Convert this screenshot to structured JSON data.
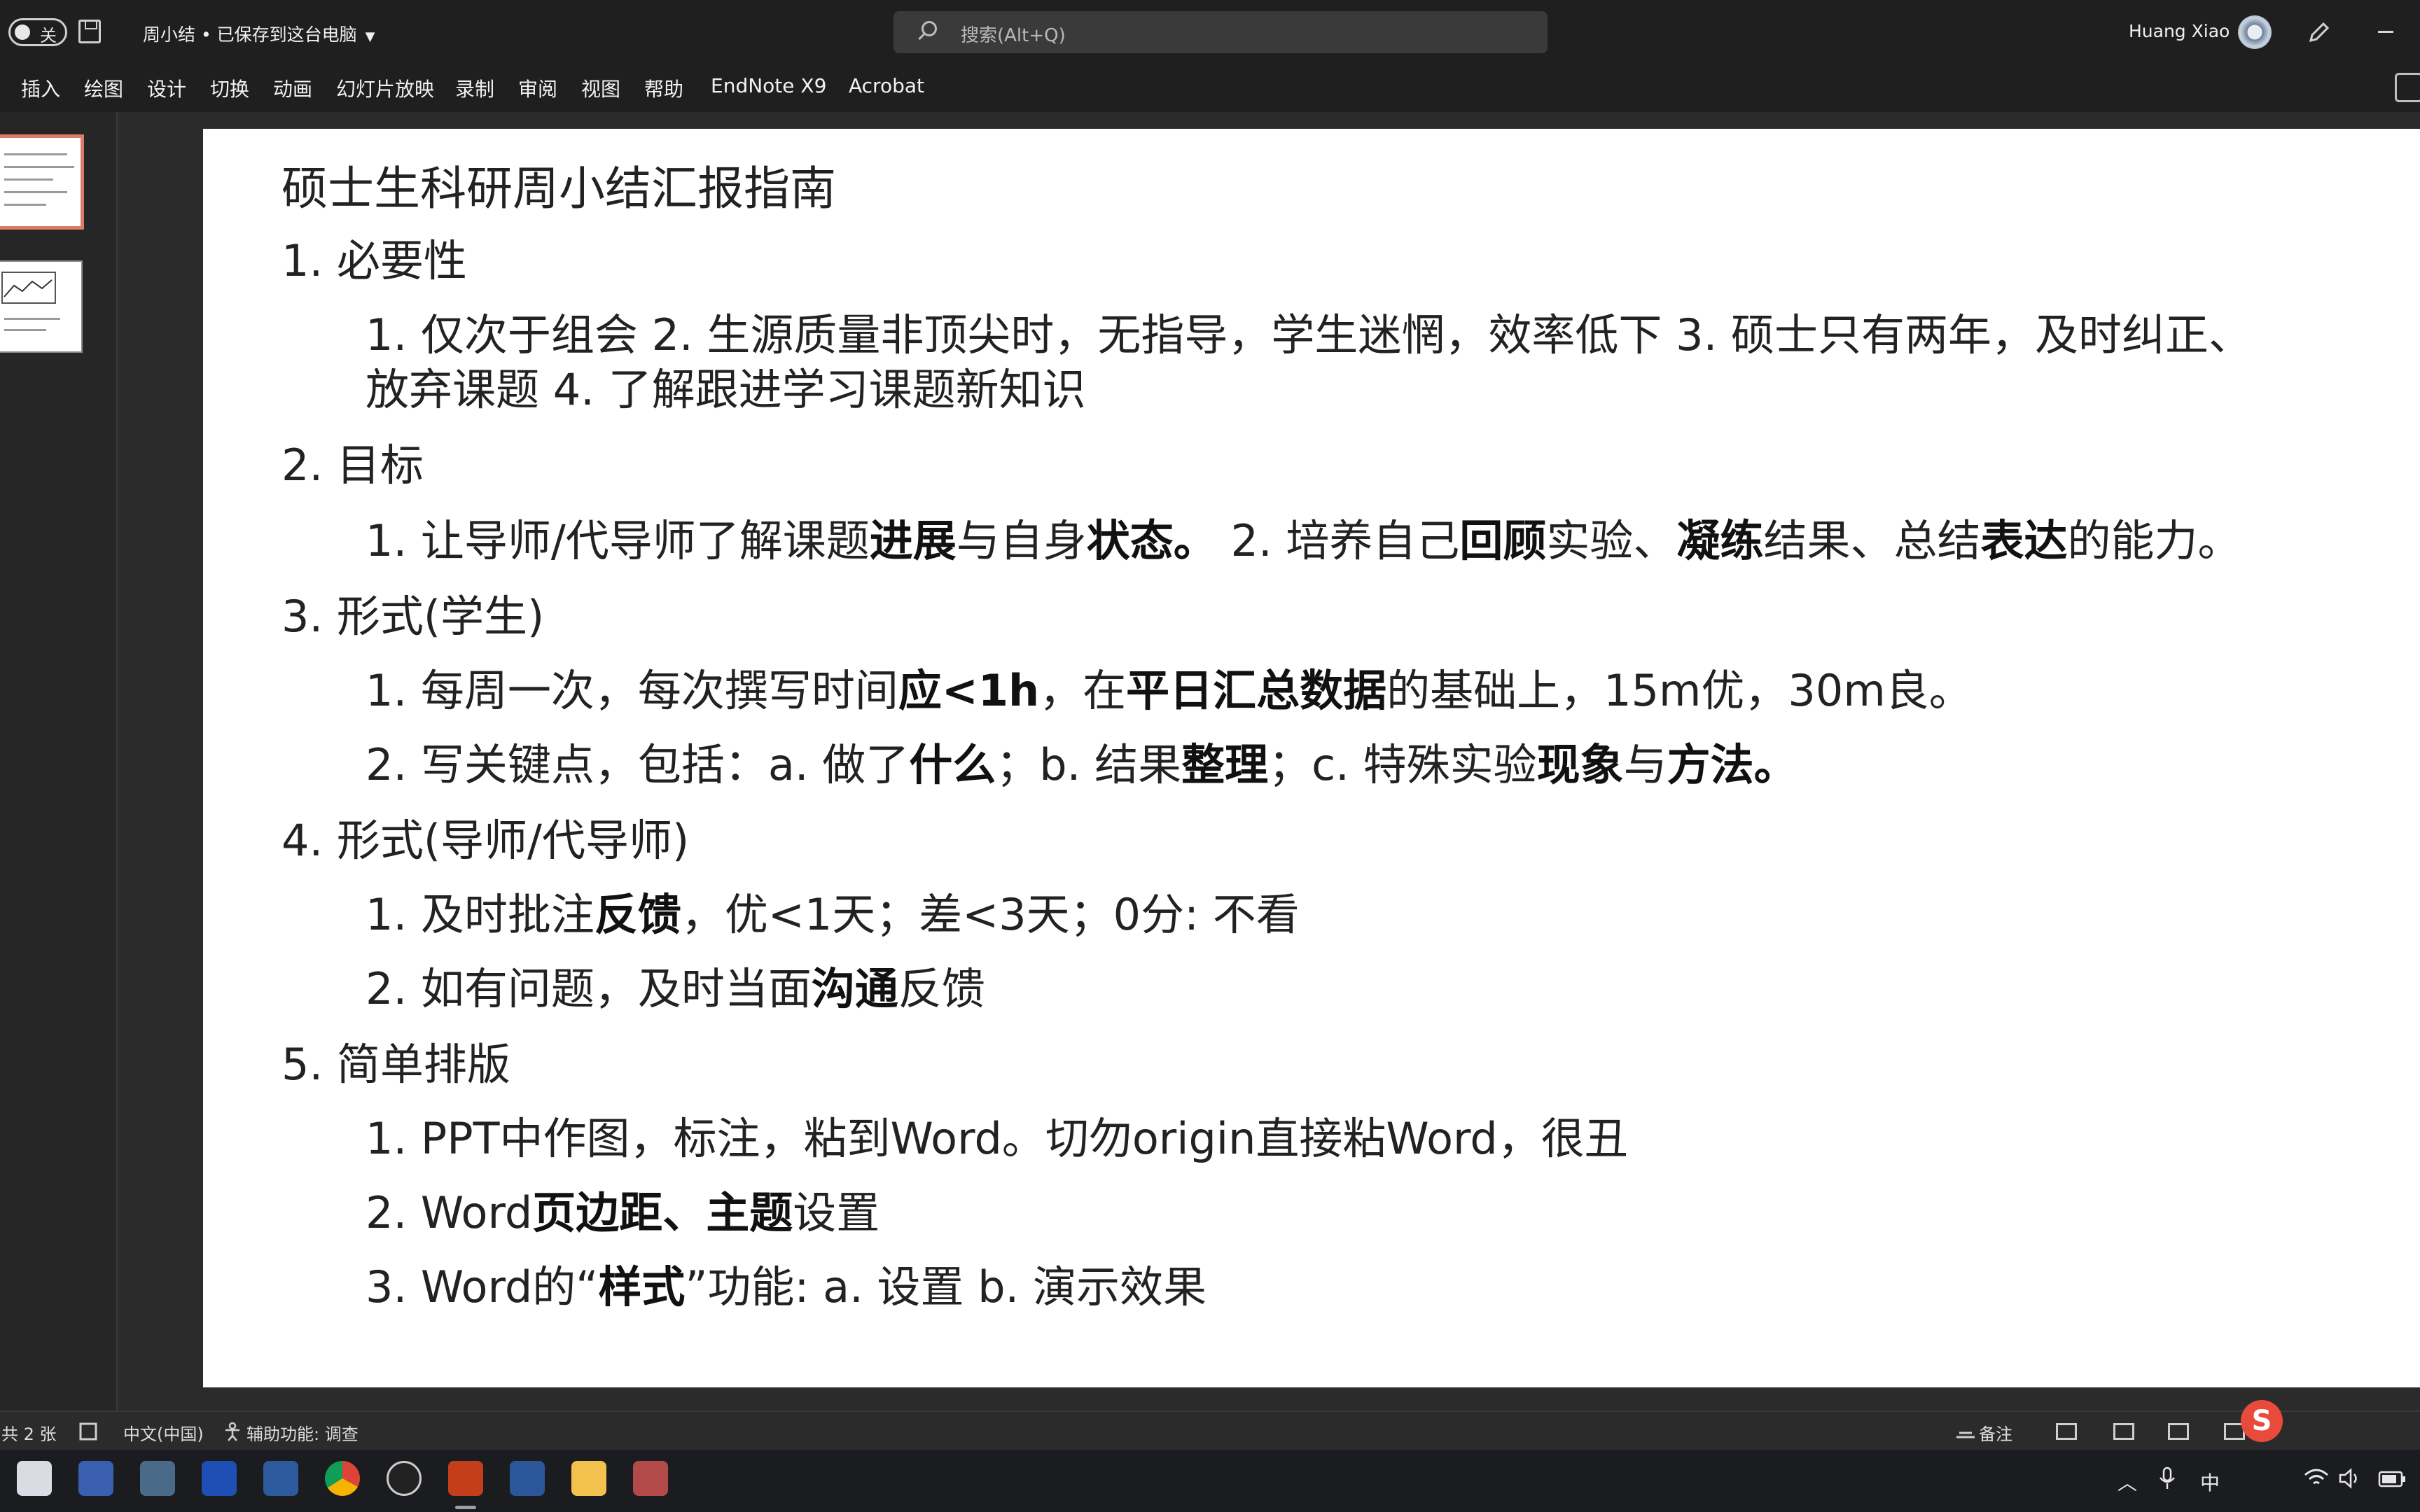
{
  "titlebar": {
    "autosave_label": "关",
    "doc_title": "周小结 • 已保存到这台电脑",
    "search_placeholder": "搜索(Alt+Q)",
    "user_name": "Huang Xiao"
  },
  "menu": {
    "items": [
      "插入",
      "绘图",
      "设计",
      "切换",
      "动画",
      "幻灯片放映",
      "录制",
      "审阅",
      "视图",
      "帮助",
      "EndNote X9",
      "Acrobat"
    ]
  },
  "slide": {
    "title": "硕士生科研周小结汇报指南",
    "lines": [
      {
        "runs": [
          {
            "t": "1.  必要性"
          }
        ]
      },
      {
        "runs": [
          {
            "t": "1. 仅次于组会 2. 生源质量非顶尖时，无指导，学生迷惘，效率低下 3. 硕士只有两年，及时纠正、"
          }
        ]
      },
      {
        "runs": [
          {
            "t": "放弃课题 4. 了解跟进学习课题新知识"
          }
        ]
      },
      {
        "runs": [
          {
            "t": "2.  目标"
          }
        ]
      },
      {
        "runs": [
          {
            "t": "1.  让导师/代导师了解课题"
          },
          {
            "t": "进展",
            "b": true
          },
          {
            "t": "与自身"
          },
          {
            "t": "状态。",
            "b": true
          },
          {
            "t": "  2. 培养自己"
          },
          {
            "t": "回顾",
            "b": true
          },
          {
            "t": "实验、"
          },
          {
            "t": "凝练",
            "b": true
          },
          {
            "t": "结果、总结"
          },
          {
            "t": "表达",
            "b": true
          },
          {
            "t": "的能力。"
          }
        ]
      },
      {
        "runs": [
          {
            "t": "3.  形式(学生)"
          }
        ]
      },
      {
        "runs": [
          {
            "t": "1.  每周一次，每次撰写时间"
          },
          {
            "t": "应<1h",
            "b": true
          },
          {
            "t": "，在"
          },
          {
            "t": "平日汇总数据",
            "b": true
          },
          {
            "t": "的基础上，15m优，30m良。"
          }
        ]
      },
      {
        "runs": [
          {
            "t": "2.  写关键点，包括：a. 做了"
          },
          {
            "t": "什么",
            "b": true
          },
          {
            "t": "；b. 结果"
          },
          {
            "t": "整理",
            "b": true
          },
          {
            "t": "；c. 特殊实验"
          },
          {
            "t": "现象",
            "b": true
          },
          {
            "t": "与"
          },
          {
            "t": "方法。",
            "b": true
          }
        ]
      },
      {
        "runs": [
          {
            "t": "4.   形式(导师/代导师)"
          }
        ]
      },
      {
        "runs": [
          {
            "t": "1.   及时批注"
          },
          {
            "t": "反馈",
            "b": true
          },
          {
            "t": "，优<1天；差<3天；0分: 不看"
          }
        ]
      },
      {
        "runs": [
          {
            "t": "2.   如有问题，及时当面"
          },
          {
            "t": "沟通",
            "b": true
          },
          {
            "t": "反馈"
          }
        ]
      },
      {
        "runs": [
          {
            "t": "5.  简单排版"
          }
        ]
      },
      {
        "runs": [
          {
            "t": "1.  PPT中作图，标注，粘到Word。切勿origin直接粘Word，很丑"
          }
        ]
      },
      {
        "runs": [
          {
            "t": "2.  Word"
          },
          {
            "t": "页边距、主题",
            "b": true
          },
          {
            "t": "设置"
          }
        ]
      },
      {
        "runs": [
          {
            "t": "3.  Word的“"
          },
          {
            "t": "样式",
            "b": true
          },
          {
            "t": "”功能:  a. 设置 b. 演示效果"
          }
        ]
      }
    ]
  },
  "status": {
    "slide_count": "共 2 张",
    "language": "中文(中国)",
    "accessibility": "辅助功能: 调查",
    "notes": "备注"
  },
  "tray": {
    "ime": "中"
  }
}
